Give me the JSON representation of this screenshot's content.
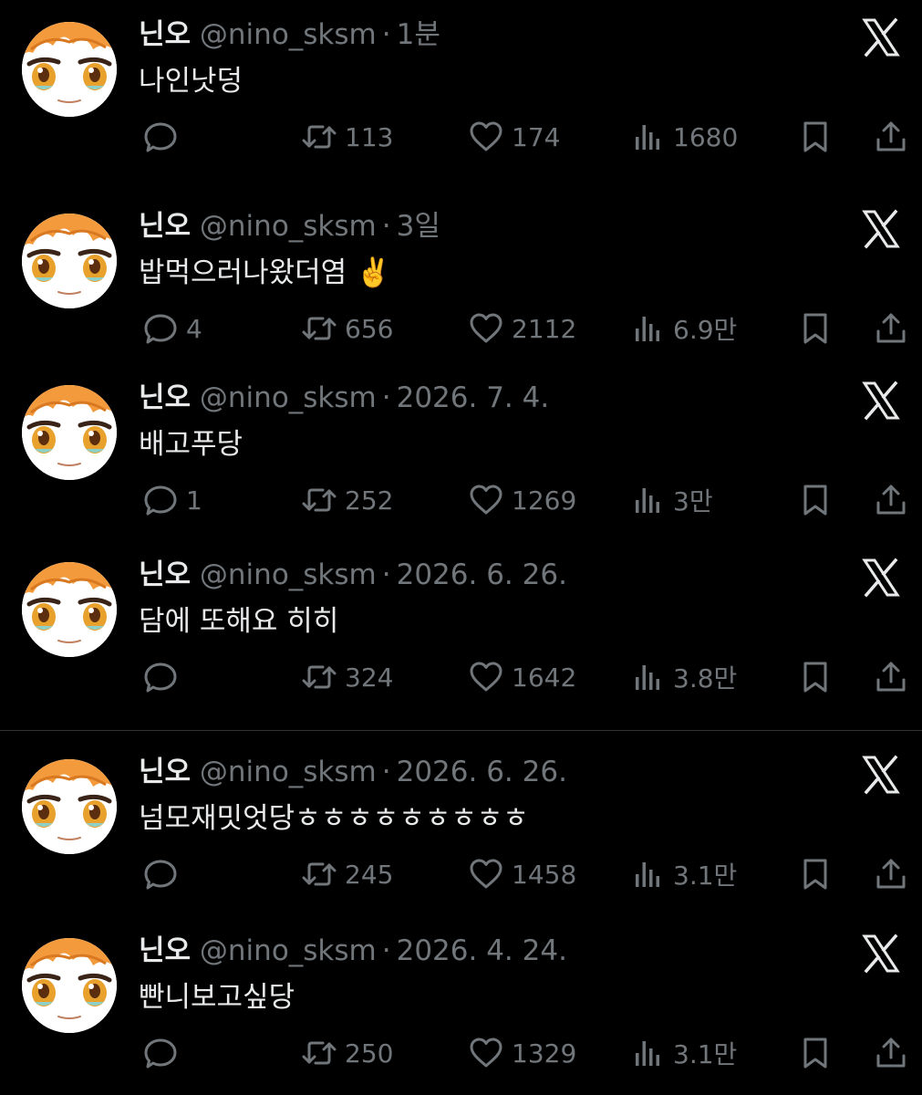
{
  "colors": {
    "background": "#000000",
    "text": "#e7e9ea",
    "muted": "#71767b",
    "avatar_hair": "#f39a3c",
    "avatar_eye": "#e8a12d"
  },
  "icons": {
    "reply": "chat-bubble-icon",
    "repost": "repost-arrows-icon",
    "like": "heart-icon",
    "views": "bar-chart-icon",
    "bookmark": "bookmark-icon",
    "share": "share-upload-icon",
    "brand": "x-logo-icon"
  },
  "tweets": [
    {
      "name": "닌오",
      "handle": "@nino_sksm",
      "dot": "·",
      "time": "1분",
      "text": "나인낫덩",
      "replies": "",
      "reposts": "113",
      "likes": "174",
      "views": "1680"
    },
    {
      "name": "닌오",
      "handle": "@nino_sksm",
      "dot": "·",
      "time": "3일",
      "text": "밥먹으러나왔더염 ✌️",
      "replies": "4",
      "reposts": "656",
      "likes": "2112",
      "views": "6.9만"
    },
    {
      "name": "닌오",
      "handle": "@nino_sksm",
      "dot": "·",
      "time": "2026. 7. 4.",
      "text": "배고푸당",
      "replies": "1",
      "reposts": "252",
      "likes": "1269",
      "views": "3만"
    },
    {
      "name": "닌오",
      "handle": "@nino_sksm",
      "dot": "·",
      "time": "2026. 6. 26.",
      "text": "담에 또해요 히히",
      "replies": "",
      "reposts": "324",
      "likes": "1642",
      "views": "3.8만"
    },
    {
      "name": "닌오",
      "handle": "@nino_sksm",
      "dot": "·",
      "time": "2026. 6. 26.",
      "text": "넘모재밋엇당ㅎㅎㅎㅎㅎㅎㅎㅎㅎ",
      "replies": "",
      "reposts": "245",
      "likes": "1458",
      "views": "3.1만"
    },
    {
      "name": "닌오",
      "handle": "@nino_sksm",
      "dot": "·",
      "time": "2026. 4. 24.",
      "text": "빤니보고싶당",
      "replies": "",
      "reposts": "250",
      "likes": "1329",
      "views": "3.1만"
    }
  ]
}
